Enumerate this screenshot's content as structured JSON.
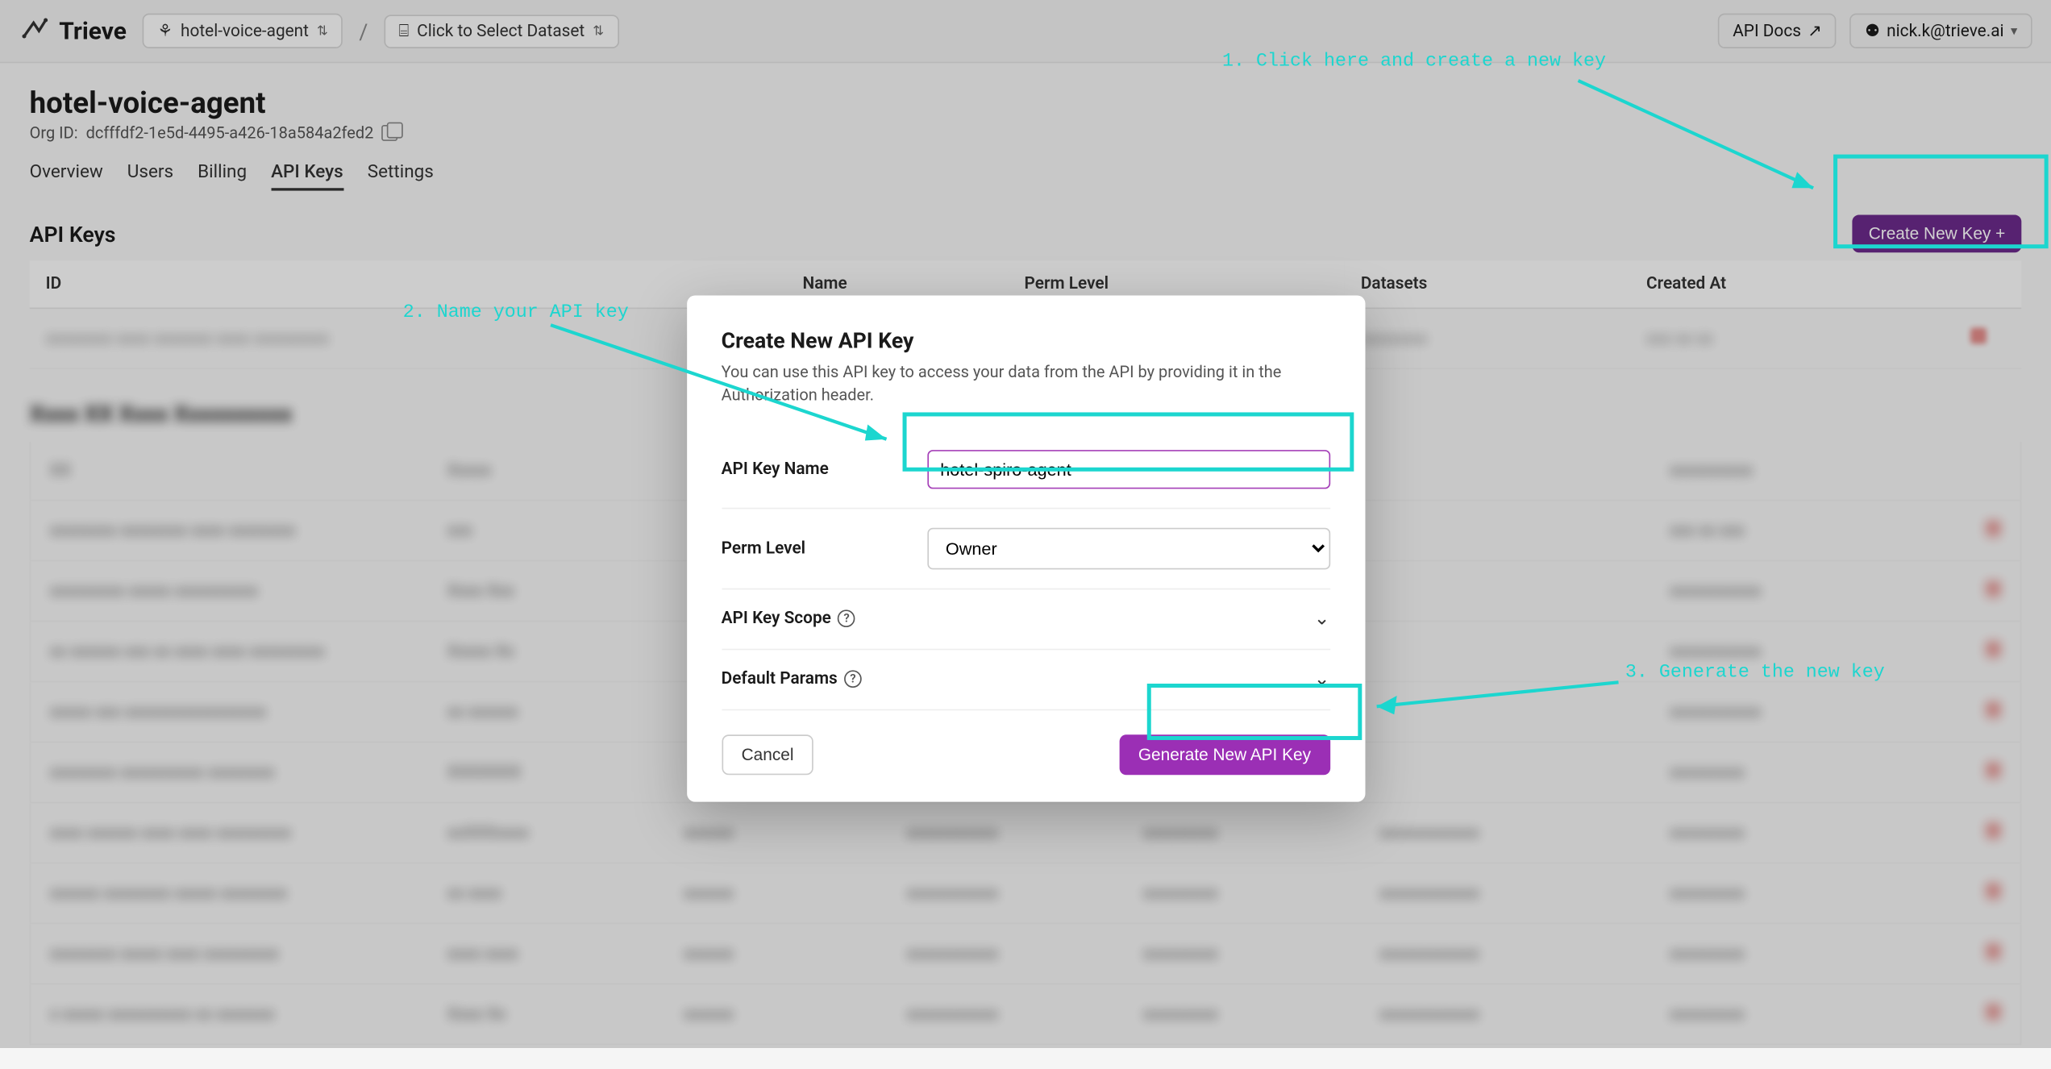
{
  "topbar": {
    "brand": "Trieve",
    "org_selector": "hotel-voice-agent",
    "dataset_selector": "Click to Select Dataset",
    "api_docs": "API Docs",
    "user": "nick.k@trieve.ai"
  },
  "page": {
    "title": "hotel-voice-agent",
    "org_id_label": "Org ID:",
    "org_id": "dcfffdf2-1e5d-4495-a426-18a584a2fed2",
    "tabs": [
      "Overview",
      "Users",
      "Billing",
      "API Keys",
      "Settings"
    ],
    "active_tab": "API Keys",
    "section_title": "API Keys",
    "create_btn": "Create New Key +"
  },
  "table": {
    "headers": [
      "ID",
      "Name",
      "Perm Level",
      "Datasets",
      "Created At",
      ""
    ]
  },
  "modal": {
    "title": "Create New API Key",
    "subtitle": "You can use this API key to access your data from the API by providing it in the Authorization header.",
    "name_label": "API Key Name",
    "name_value": "hotel-spiro-agent",
    "perm_label": "Perm Level",
    "perm_value": "Owner",
    "scope_label": "API Key Scope",
    "params_label": "Default Params",
    "cancel": "Cancel",
    "generate": "Generate New API Key"
  },
  "annotations": {
    "a1": "1. Click here and create a new key",
    "a2": "2. Name your API key",
    "a3": "3. Generate the new key"
  }
}
